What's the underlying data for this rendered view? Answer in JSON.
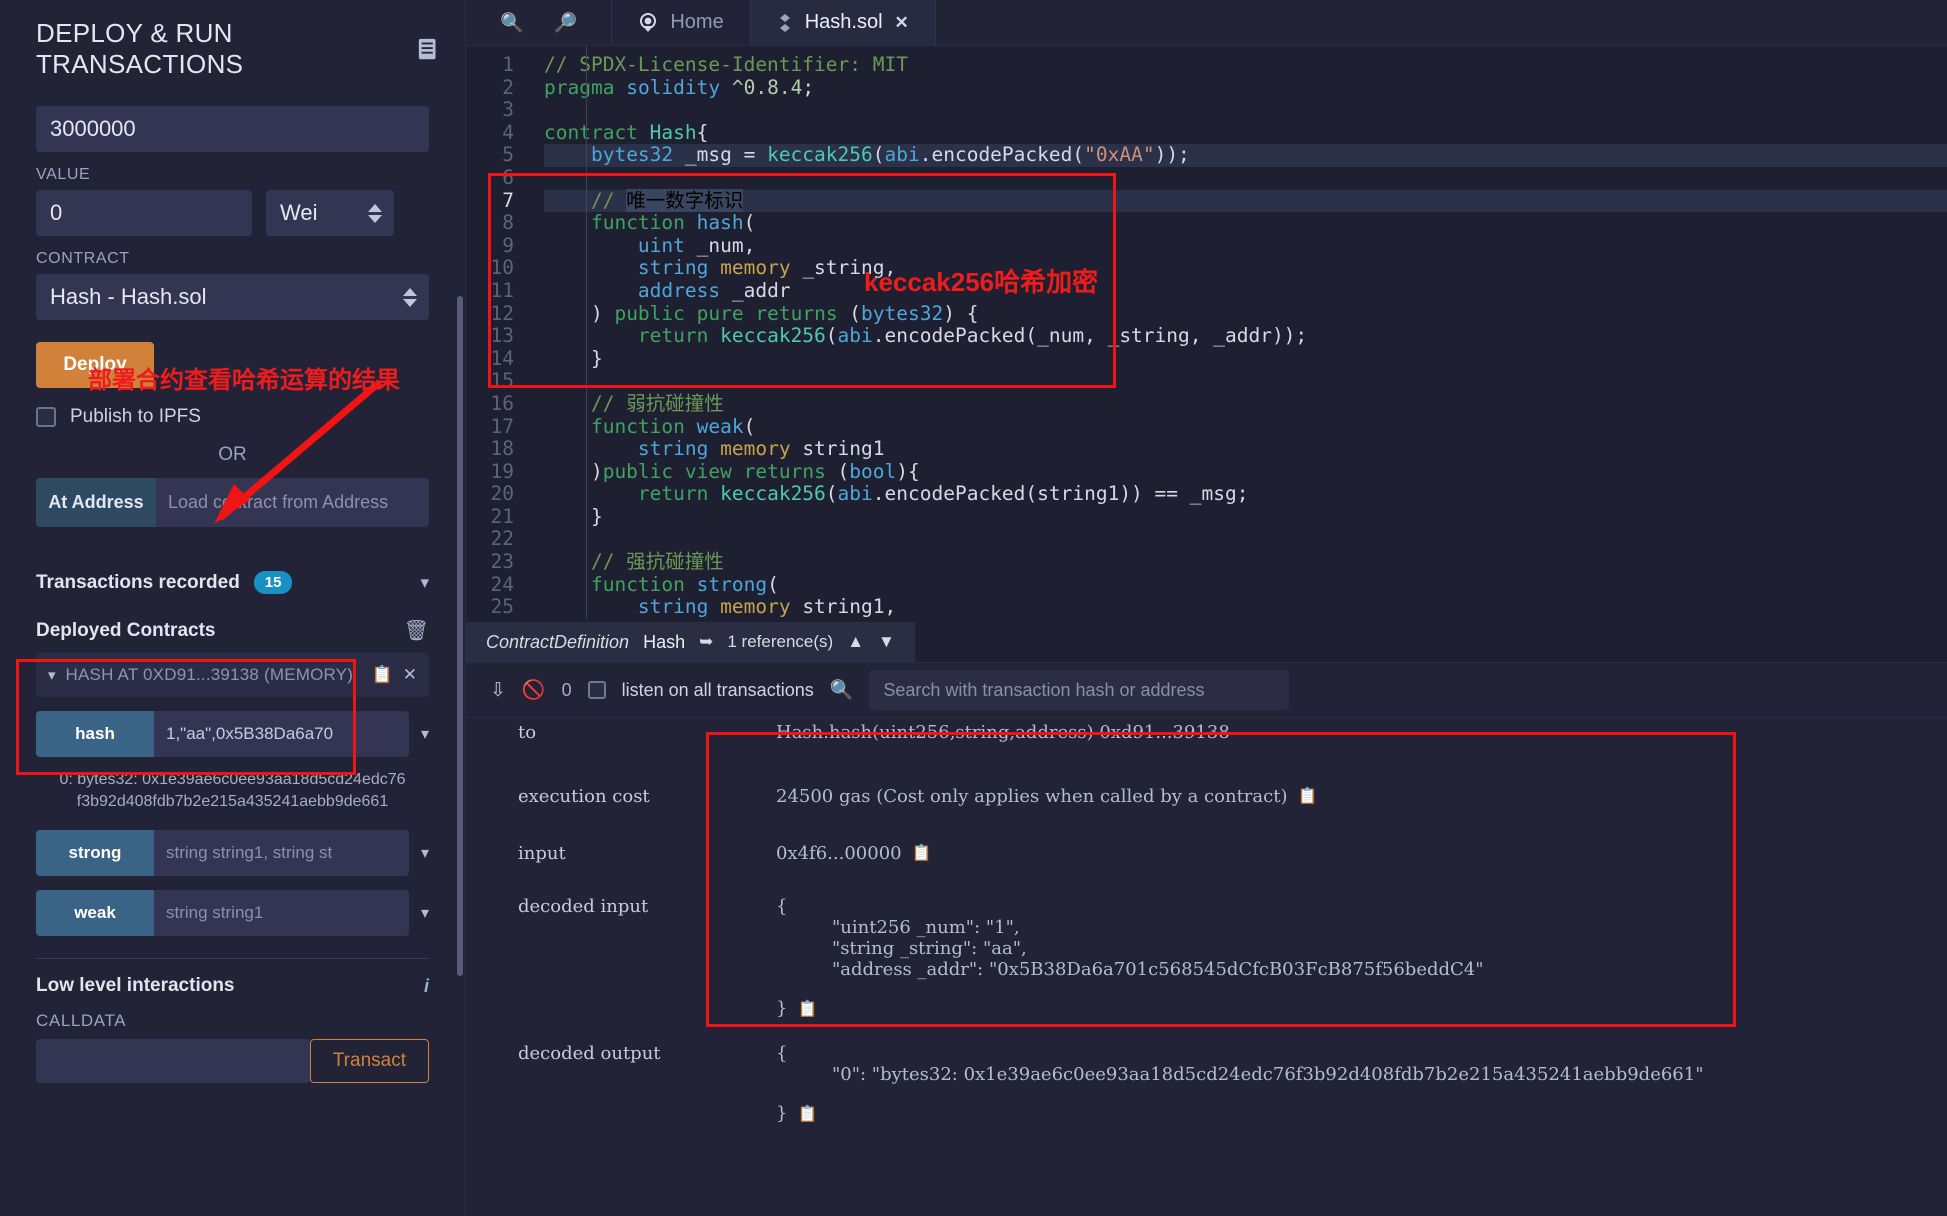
{
  "left_panel": {
    "title": "DEPLOY & RUN TRANSACTIONS",
    "doc_icon": "document-icon",
    "gas_limit_value": "3000000",
    "value_label": "VALUE",
    "value_amount": "0",
    "value_unit": "Wei",
    "contract_label": "CONTRACT",
    "contract_selected": "Hash - Hash.sol",
    "deploy_label": "Deploy",
    "publish_ipfs_label": "Publish to IPFS",
    "or_label": "OR",
    "at_address_label": "At Address",
    "at_address_placeholder": "Load contract from Address",
    "transactions_recorded_label": "Transactions recorded",
    "transactions_recorded_count": "15",
    "deployed_contracts_label": "Deployed Contracts",
    "deployed_contract_title": "HASH AT 0XD91...39138 (MEMORY)",
    "functions": [
      {
        "name": "hash",
        "args": "1,\"aa\",0x5B38Da6a70",
        "is_placeholder": false,
        "result": "0: bytes32: 0x1e39ae6c0ee93aa18d5cd24edc76f3b92d408fdb7b2e215a435241aebb9de661"
      },
      {
        "name": "strong",
        "args": "string string1, string st",
        "is_placeholder": true,
        "result": ""
      },
      {
        "name": "weak",
        "args": "string string1",
        "is_placeholder": true,
        "result": ""
      }
    ],
    "low_level_interactions_label": "Low level interactions",
    "calldata_label": "CALLDATA",
    "calldata_value": "",
    "transact_label": "Transact",
    "annotation_cn": "部署合约查看哈希运算的结果"
  },
  "tabbar": {
    "zoom_out_icon": "zoom-out-icon",
    "zoom_in_icon": "zoom-in-icon",
    "home_icon": "home-icon",
    "home_label": "Home",
    "file_icon": "solidity-icon",
    "file_label": "Hash.sol",
    "close_icon": "close-icon"
  },
  "editor": {
    "annotation_cn": "keccak256哈希加密",
    "lines": [
      {
        "n": "1",
        "tokens": [
          [
            "com",
            "// SPDX-License-Identifier: MIT"
          ]
        ]
      },
      {
        "n": "2",
        "tokens": [
          [
            "kw2",
            "pragma"
          ],
          [
            "var",
            " "
          ],
          [
            "kw",
            "solidity"
          ],
          [
            "var",
            " "
          ],
          [
            "num",
            "^0.8.4"
          ],
          [
            "var",
            ";"
          ]
        ]
      },
      {
        "n": "3",
        "tokens": []
      },
      {
        "n": "4",
        "tokens": [
          [
            "kw2",
            "contract"
          ],
          [
            "var",
            " "
          ],
          [
            "cls",
            "Hash"
          ],
          [
            "var",
            "{"
          ]
        ]
      },
      {
        "n": "5",
        "tokens": [
          [
            "var",
            "    "
          ],
          [
            "type",
            "bytes32"
          ],
          [
            "var",
            " _msg = "
          ],
          [
            "fn",
            "keccak256"
          ],
          [
            "var",
            "("
          ],
          [
            "type",
            "abi"
          ],
          [
            "var",
            "."
          ],
          [
            "var",
            "encodePacked"
          ],
          [
            "var",
            "("
          ],
          [
            "str",
            "\"0xAA\""
          ],
          [
            "var",
            "));"
          ]
        ]
      },
      {
        "n": "6",
        "tokens": []
      },
      {
        "n": "7",
        "tokens": [
          [
            "var",
            "    "
          ],
          [
            "com",
            "// "
          ],
          [
            "selcn",
            "唯一数字标识"
          ]
        ]
      },
      {
        "n": "8",
        "tokens": [
          [
            "var",
            "    "
          ],
          [
            "kw2",
            "function"
          ],
          [
            "var",
            " "
          ],
          [
            "kw",
            "hash"
          ],
          [
            "var",
            "("
          ]
        ]
      },
      {
        "n": "9",
        "tokens": [
          [
            "var",
            "        "
          ],
          [
            "type",
            "uint"
          ],
          [
            "var",
            " _num,"
          ]
        ]
      },
      {
        "n": "10",
        "tokens": [
          [
            "var",
            "        "
          ],
          [
            "type",
            "string"
          ],
          [
            "var",
            " "
          ],
          [
            "mem",
            "memory"
          ],
          [
            "var",
            " _string,"
          ]
        ]
      },
      {
        "n": "11",
        "tokens": [
          [
            "var",
            "        "
          ],
          [
            "type",
            "address"
          ],
          [
            "var",
            " _addr"
          ]
        ]
      },
      {
        "n": "12",
        "tokens": [
          [
            "var",
            "    ) "
          ],
          [
            "kw2",
            "public"
          ],
          [
            "var",
            " "
          ],
          [
            "kw2",
            "pure"
          ],
          [
            "var",
            " "
          ],
          [
            "kw2",
            "returns"
          ],
          [
            "var",
            " ("
          ],
          [
            "type",
            "bytes32"
          ],
          [
            "var",
            ") {"
          ]
        ]
      },
      {
        "n": "13",
        "tokens": [
          [
            "var",
            "        "
          ],
          [
            "kw2",
            "return"
          ],
          [
            "var",
            " "
          ],
          [
            "fn",
            "keccak256"
          ],
          [
            "var",
            "("
          ],
          [
            "type",
            "abi"
          ],
          [
            "var",
            ".encodePacked(_num, _string, _addr));"
          ]
        ]
      },
      {
        "n": "14",
        "tokens": [
          [
            "var",
            "    }"
          ]
        ]
      },
      {
        "n": "15",
        "tokens": []
      },
      {
        "n": "16",
        "tokens": [
          [
            "var",
            "    "
          ],
          [
            "com",
            "// 弱抗碰撞性"
          ]
        ]
      },
      {
        "n": "17",
        "tokens": [
          [
            "var",
            "    "
          ],
          [
            "kw2",
            "function"
          ],
          [
            "var",
            " "
          ],
          [
            "kw",
            "weak"
          ],
          [
            "var",
            "("
          ]
        ]
      },
      {
        "n": "18",
        "tokens": [
          [
            "var",
            "        "
          ],
          [
            "type",
            "string"
          ],
          [
            "var",
            " "
          ],
          [
            "mem",
            "memory"
          ],
          [
            "var",
            " string1"
          ]
        ]
      },
      {
        "n": "19",
        "tokens": [
          [
            "var",
            "    )"
          ],
          [
            "kw2",
            "public"
          ],
          [
            "var",
            " "
          ],
          [
            "kw2",
            "view"
          ],
          [
            "var",
            " "
          ],
          [
            "kw2",
            "returns"
          ],
          [
            "var",
            " ("
          ],
          [
            "type",
            "bool"
          ],
          [
            "var",
            "){"
          ]
        ]
      },
      {
        "n": "20",
        "tokens": [
          [
            "var",
            "        "
          ],
          [
            "kw2",
            "return"
          ],
          [
            "var",
            " "
          ],
          [
            "fn",
            "keccak256"
          ],
          [
            "var",
            "("
          ],
          [
            "type",
            "abi"
          ],
          [
            "var",
            ".encodePacked(string1)) == _msg;"
          ]
        ]
      },
      {
        "n": "21",
        "tokens": [
          [
            "var",
            "    }"
          ]
        ]
      },
      {
        "n": "22",
        "tokens": []
      },
      {
        "n": "23",
        "tokens": [
          [
            "var",
            "    "
          ],
          [
            "com",
            "// 强抗碰撞性"
          ]
        ]
      },
      {
        "n": "24",
        "tokens": [
          [
            "var",
            "    "
          ],
          [
            "kw2",
            "function"
          ],
          [
            "var",
            " "
          ],
          [
            "kw",
            "strong"
          ],
          [
            "var",
            "("
          ]
        ]
      },
      {
        "n": "25",
        "tokens": [
          [
            "var",
            "        "
          ],
          [
            "type",
            "string"
          ],
          [
            "var",
            " "
          ],
          [
            "mem",
            "memory"
          ],
          [
            "var",
            " string1,"
          ]
        ]
      }
    ]
  },
  "context_bar": {
    "kind": "ContractDefinition",
    "name": "Hash",
    "jump_icon": "jump-to-icon",
    "references": "1 reference(s)",
    "up_icon": "chevron-up-icon",
    "down_icon": "chevron-down-icon"
  },
  "terminal_bar": {
    "collapse_icon": "double-chevron-down-icon",
    "block_icon": "no-entry-icon",
    "pending_count": "0",
    "listen_label": "listen on all transactions",
    "search_icon": "search-icon",
    "search_placeholder": "Search with transaction hash or address"
  },
  "terminal": {
    "clipped_row": {
      "key": "to",
      "value": "Hash.hash(uint256,string,address) 0xd91...39138"
    },
    "rows": [
      {
        "key": "execution cost",
        "value": "24500 gas (Cost only applies when called by a contract)",
        "copy_icon": "copy-icon"
      },
      {
        "key": "input",
        "value": "0x4f6...00000",
        "copy_icon": "copy-icon"
      }
    ],
    "decoded_input": {
      "key": "decoded input",
      "open_brace": "{",
      "entries": [
        "\"uint256 _num\": \"1\",",
        "\"string _string\": \"aa\",",
        "\"address _addr\": \"0x5B38Da6a701c568545dCfcB03FcB875f56beddC4\""
      ],
      "close_brace": "}",
      "copy_icon": "copy-icon"
    },
    "decoded_output": {
      "key": "decoded output",
      "open_brace": "{",
      "entries": [
        "\"0\": \"bytes32: 0x1e39ae6c0ee93aa18d5cd24edc76f3b92d408fdb7b2e215a435241aebb9de661\""
      ],
      "close_brace": "}",
      "copy_icon": "copy-icon"
    }
  },
  "colors": {
    "background": "#222336",
    "panel": "#1f2034",
    "accent_orange": "#d2813a",
    "accent_blue": "#3a6486",
    "badge_blue": "#1a8fc4",
    "annotation_red": "#ee1c1c"
  }
}
